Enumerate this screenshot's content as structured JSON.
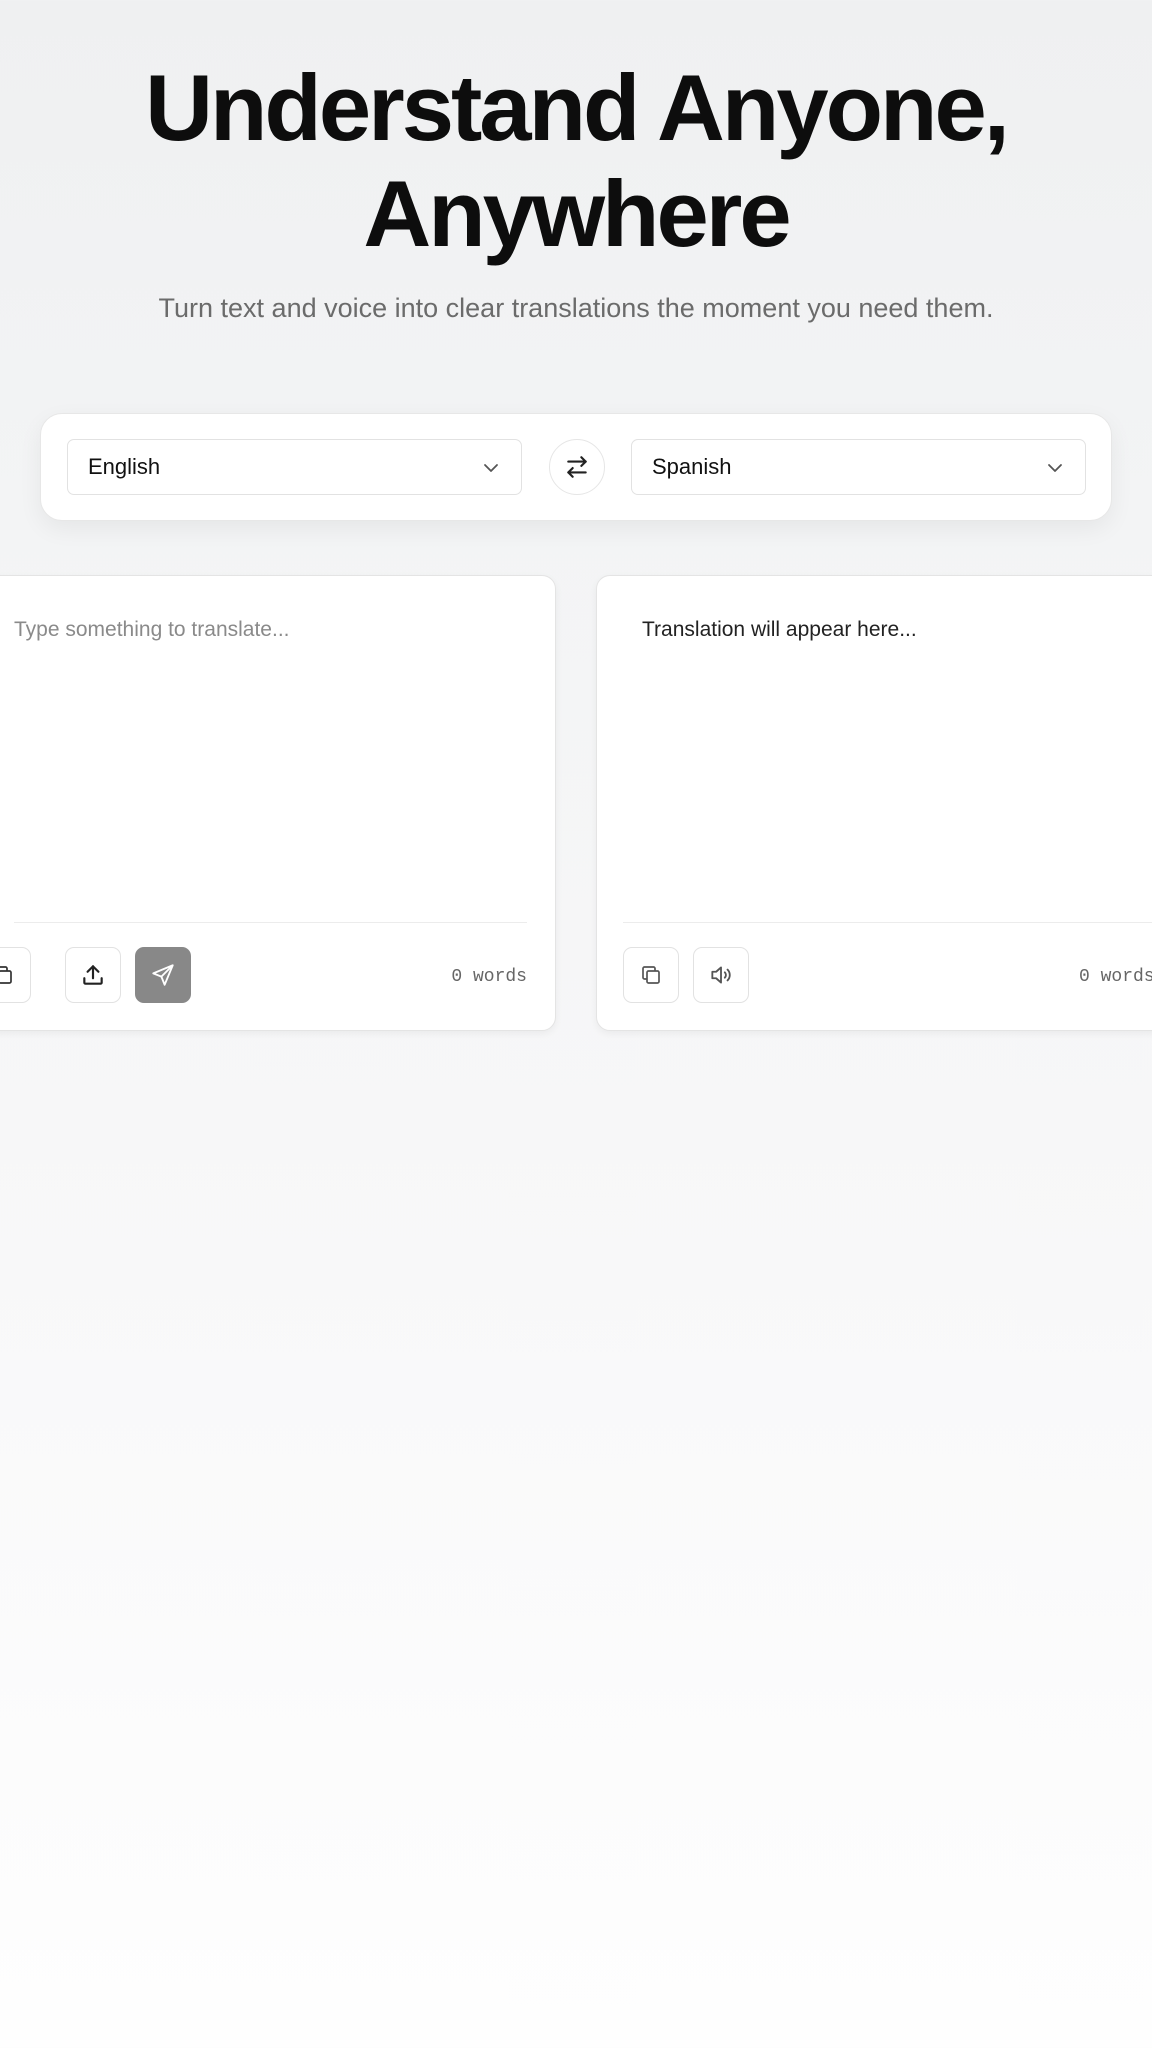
{
  "hero": {
    "title_line1": "Understand Anyone,",
    "title_line2": "Anywhere",
    "subtitle": "Turn text and voice into clear translations the moment you need them."
  },
  "language_bar": {
    "source_language": "English",
    "target_language": "Spanish",
    "swap_icon": "swap-arrows-icon",
    "dropdown_icon": "chevron-down-icon"
  },
  "source_panel": {
    "placeholder": "Type something to translate...",
    "value": "",
    "word_count": "0 words",
    "actions": [
      "copy-icon",
      "upload-icon",
      "send-icon"
    ]
  },
  "target_panel": {
    "placeholder": "Translation will appear here...",
    "word_count": "0 words",
    "actions": [
      "copy-icon",
      "speaker-icon"
    ]
  },
  "colors": {
    "send_button": "#888888",
    "title": "#0d0d0d",
    "subtitle": "#6b6b6b"
  }
}
